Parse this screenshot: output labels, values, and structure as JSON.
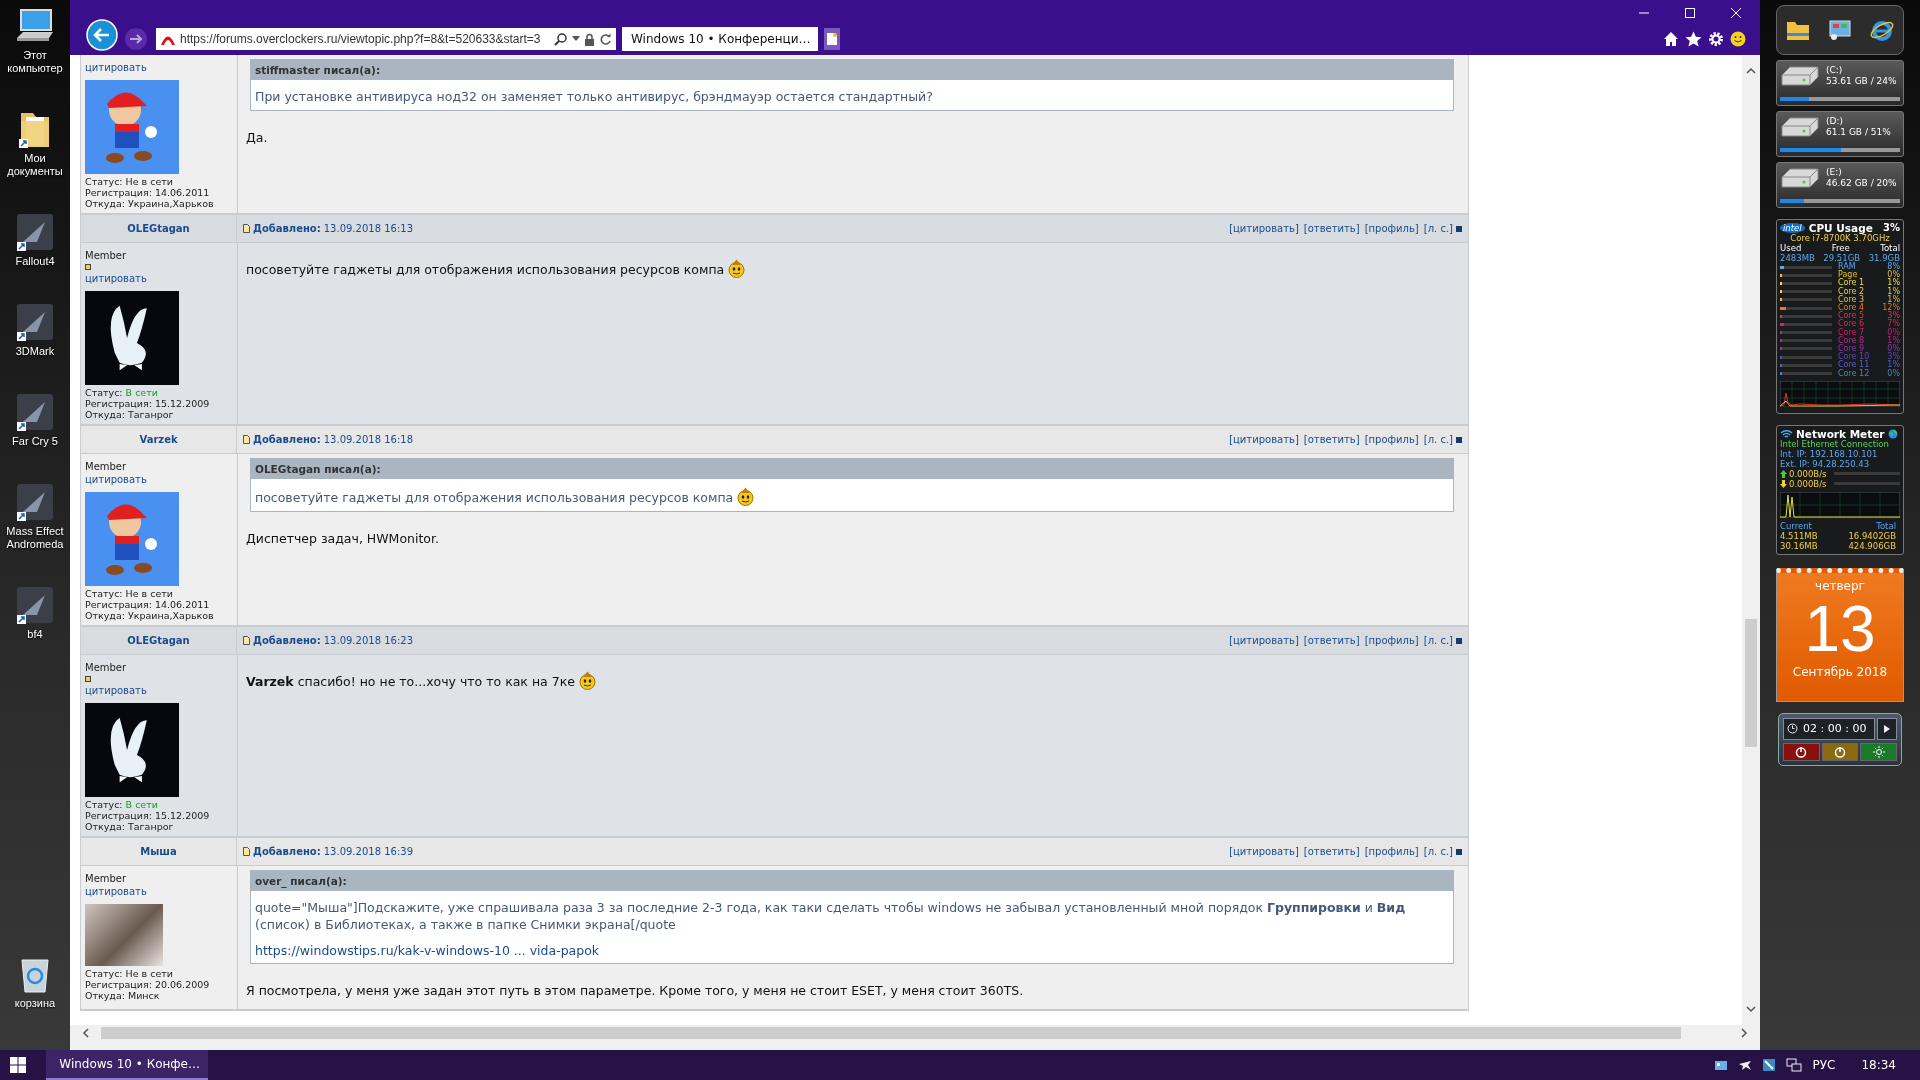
{
  "desktop_icons": [
    {
      "label": "Этот компьютер",
      "kind": "computer"
    },
    {
      "label": "Мои документы",
      "kind": "folder"
    },
    {
      "label": "Fallout4",
      "kind": "app"
    },
    {
      "label": "3DMark",
      "kind": "app"
    },
    {
      "label": "Far Cry 5",
      "kind": "app"
    },
    {
      "label": "Mass Effect Andromeda",
      "kind": "app"
    },
    {
      "label": "bf4",
      "kind": "app"
    },
    {
      "label": "корзина",
      "kind": "trash"
    }
  ],
  "browser": {
    "url": "https://forums.overclockers.ru/viewtopic.php?f=8&t=520633&start=3",
    "tab_title": "Windows 10 • Конференци…"
  },
  "posts": [
    {
      "cite": "цитировать",
      "avatar": {
        "kind": "cartoon"
      },
      "status_label": "Статус:",
      "status": "Не в сети",
      "online": false,
      "reg_label": "Регистрация:",
      "reg": "14.06.2011",
      "from_label": "Откуда:",
      "from": "Украина,Харьков",
      "quote": {
        "author": "stiffmaster писал(а):",
        "text": "При установке антивируса нод32 он заменяет только антивирус, брэндмауэр остается стандартный?",
        "smiley": false
      },
      "text": "Да.",
      "smiley": false
    },
    {
      "author": "OLEGtagan",
      "added_label": "Добавлено:",
      "date": "13.09.2018 16:13",
      "actions": [
        "[цитировать]",
        "[ответить]",
        "[профиль]",
        "[л. с.]"
      ],
      "rank": "Member",
      "rank_dot": true,
      "cite": "цитировать",
      "avatar": {
        "kind": "rabbit"
      },
      "status_label": "Статус:",
      "status": "В сети",
      "online": true,
      "reg_label": "Регистрация:",
      "reg": "15.12.2009",
      "from_label": "Откуда:",
      "from": "Таганрог",
      "text": "посоветуйте гаджеты для отображения использования ресурсов компа",
      "smiley": true
    },
    {
      "author": "Varzek",
      "added_label": "Добавлено:",
      "date": "13.09.2018 16:18",
      "actions": [
        "[цитировать]",
        "[ответить]",
        "[профиль]",
        "[л. с.]"
      ],
      "rank": "Member",
      "rank_dot": false,
      "cite": "цитировать",
      "avatar": {
        "kind": "cartoon"
      },
      "status_label": "Статус:",
      "status": "Не в сети",
      "online": false,
      "reg_label": "Регистрация:",
      "reg": "14.06.2011",
      "from_label": "Откуда:",
      "from": "Украина,Харьков",
      "quote": {
        "author": "OLEGtagan писал(а):",
        "text": "посоветуйте гаджеты для отображения использования ресурсов компа",
        "smiley": true
      },
      "text": "Диспетчер задач, HWMonitor.",
      "smiley": false
    },
    {
      "author": "OLEGtagan",
      "added_label": "Добавлено:",
      "date": "13.09.2018 16:23",
      "actions": [
        "[цитировать]",
        "[ответить]",
        "[профиль]",
        "[л. с.]"
      ],
      "rank": "Member",
      "rank_dot": true,
      "cite": "цитировать",
      "avatar": {
        "kind": "rabbit"
      },
      "status_label": "Статус:",
      "status": "В сети",
      "online": true,
      "reg_label": "Регистрация:",
      "reg": "15.12.2009",
      "from_label": "Откуда:",
      "from": "Таганрог",
      "text": "**Varzek** спасибо! но не то...хочу что то как на 7ке",
      "smiley": true
    },
    {
      "author": "Мыша",
      "added_label": "Добавлено:",
      "date": "13.09.2018 16:39",
      "actions": [
        "[цитировать]",
        "[ответить]",
        "[профиль]",
        "[л. с.]"
      ],
      "rank": "Member",
      "rank_dot": false,
      "cite": "цитировать",
      "avatar": {
        "kind": "photo"
      },
      "status_label": "Статус:",
      "status": "Не в сети",
      "online": false,
      "reg_label": "Регистрация:",
      "reg": "20.06.2009",
      "from_label": "Откуда:",
      "from": "Минск",
      "quote": {
        "author": "over_ писал(а):",
        "text": "quote=\"Мыша\"]Подскажите, уже спрашивала раза 3 за последние 2-3 года, как таки сделать чтобы windows не забывал установленный мной порядок **Группировки** и **Вид** (список) в Библиотеках, а также в папке Снимки экрана[/quote",
        "link": "https://windowstips.ru/kak-v-windows-10 ... vida-papok",
        "smiley": false
      },
      "text": "Я посмотрела, у меня уже задан этот путь в этом параметре. Кроме того, у меня не стоит ESET, у меня стоит 360TS.",
      "smiley": false
    }
  ],
  "drives": [
    {
      "label": "(C:)",
      "info": "53.61 GB / 24%",
      "level": 0.24
    },
    {
      "label": "(D:)",
      "info": "61.1 GB / 51%",
      "level": 0.51
    },
    {
      "label": "(E:)",
      "info": "46.62 GB / 20%",
      "level": 0.2
    }
  ],
  "cpu": {
    "logo": "intel",
    "title": "CPU Usage",
    "total": "3%",
    "model": "Core i7-8700K 3.70GHz",
    "headers": [
      "Used",
      "Free",
      "Total"
    ],
    "values": [
      "2483MB",
      "29.51GB",
      "31.9GB"
    ],
    "rows": [
      {
        "label": "RAM",
        "value": "8%",
        "level": 0.08,
        "color": "#5aa8f0"
      },
      {
        "label": "Page",
        "value": "0%",
        "level": 0.0,
        "color": "#e8c020"
      },
      {
        "label": "Core 1",
        "value": "1%",
        "level": 0.01,
        "color": "#e8e040"
      },
      {
        "label": "Core 2",
        "value": "1%",
        "level": 0.01,
        "color": "#e8d838"
      },
      {
        "label": "Core 3",
        "value": "1%",
        "level": 0.01,
        "color": "#e8c030"
      },
      {
        "label": "Core 4",
        "value": "12%",
        "level": 0.12,
        "color": "#e87820"
      },
      {
        "label": "Core 5",
        "value": "3%",
        "level": 0.03,
        "color": "#e83050"
      },
      {
        "label": "Core 6",
        "value": "7%",
        "level": 0.07,
        "color": "#e02058"
      },
      {
        "label": "Core 7",
        "value": "0%",
        "level": 0.0,
        "color": "#d01870"
      },
      {
        "label": "Core 8",
        "value": "1%",
        "level": 0.01,
        "color": "#b82888"
      },
      {
        "label": "Core 9",
        "value": "0%",
        "level": 0.0,
        "color": "#8838a8"
      },
      {
        "label": "Core 10",
        "value": "3%",
        "level": 0.03,
        "color": "#6048b8"
      },
      {
        "label": "Core 11",
        "value": "1%",
        "level": 0.01,
        "color": "#5060c8"
      },
      {
        "label": "Core 12",
        "value": "0%",
        "level": 0.0,
        "color": "#4a80c8"
      }
    ]
  },
  "network": {
    "title": "Network Meter",
    "adapter": "Intel Ethernet Connection",
    "int_ip": "Int. IP: 192.168.10.101",
    "ext_ip": "Ext. IP: 94.28.250.43",
    "up": "0.000B/s",
    "down": "0.000B/s",
    "current_label": "Current",
    "total_label": "Total",
    "current_up": "4.511MB",
    "total_up": "16.9402GB",
    "current_down": "30.16MB",
    "total_down": "424.906GB"
  },
  "calendar": {
    "weekday": "четверг",
    "day": "13",
    "month": "Сентябрь 2018"
  },
  "timer": {
    "time": "02 : 00 : 00"
  },
  "taskbar": {
    "task": "Windows 10 • Конфе…",
    "lang": "РУС",
    "time": "18:34"
  }
}
